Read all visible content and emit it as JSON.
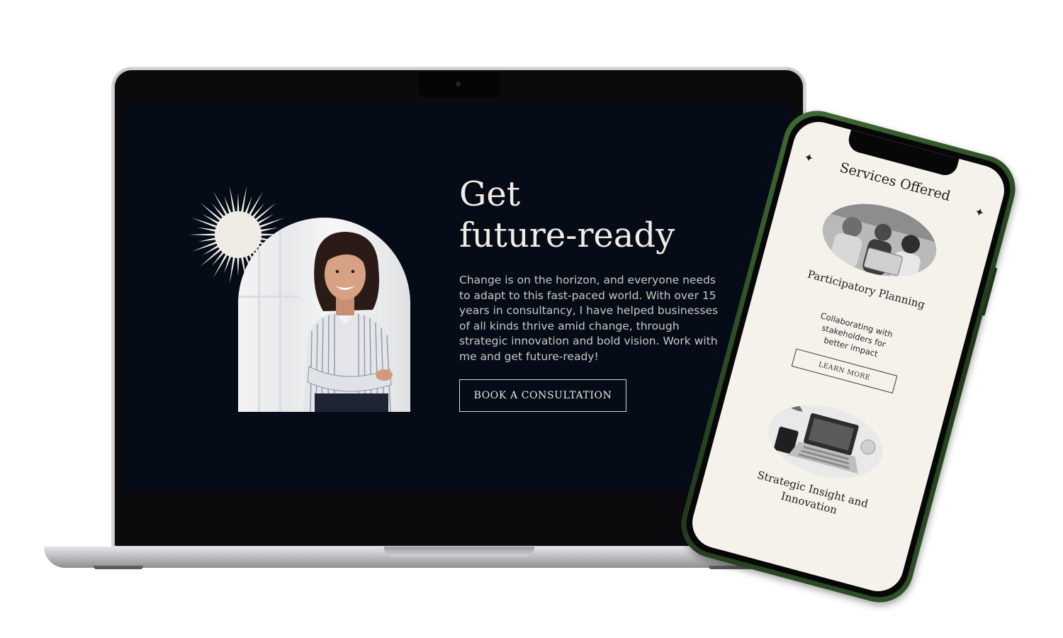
{
  "hero": {
    "title_line1": "Get",
    "title_line2": "future-ready",
    "body": "Change is on the horizon, and everyone needs to adapt to this fast-paced world. With over 15 years in consultancy, I have helped businesses of all kinds thrive amid change, through strategic innovation and bold vision. Work with me and get future-ready!",
    "cta_label": "BOOK A CONSULTATION"
  },
  "services": {
    "title": "Services Offered",
    "star": "✦",
    "items": [
      {
        "title": "Participatory Planning",
        "description": "Collaborating with stakeholders for better impact",
        "button_label": "LEARN MORE"
      },
      {
        "title": "Strategic Insight and Innovation"
      }
    ]
  },
  "colors": {
    "screen_bg": "#060c17",
    "cream": "#f1ede4",
    "phone_green": "#2f5227",
    "phone_screen": "#f5f2ec"
  }
}
